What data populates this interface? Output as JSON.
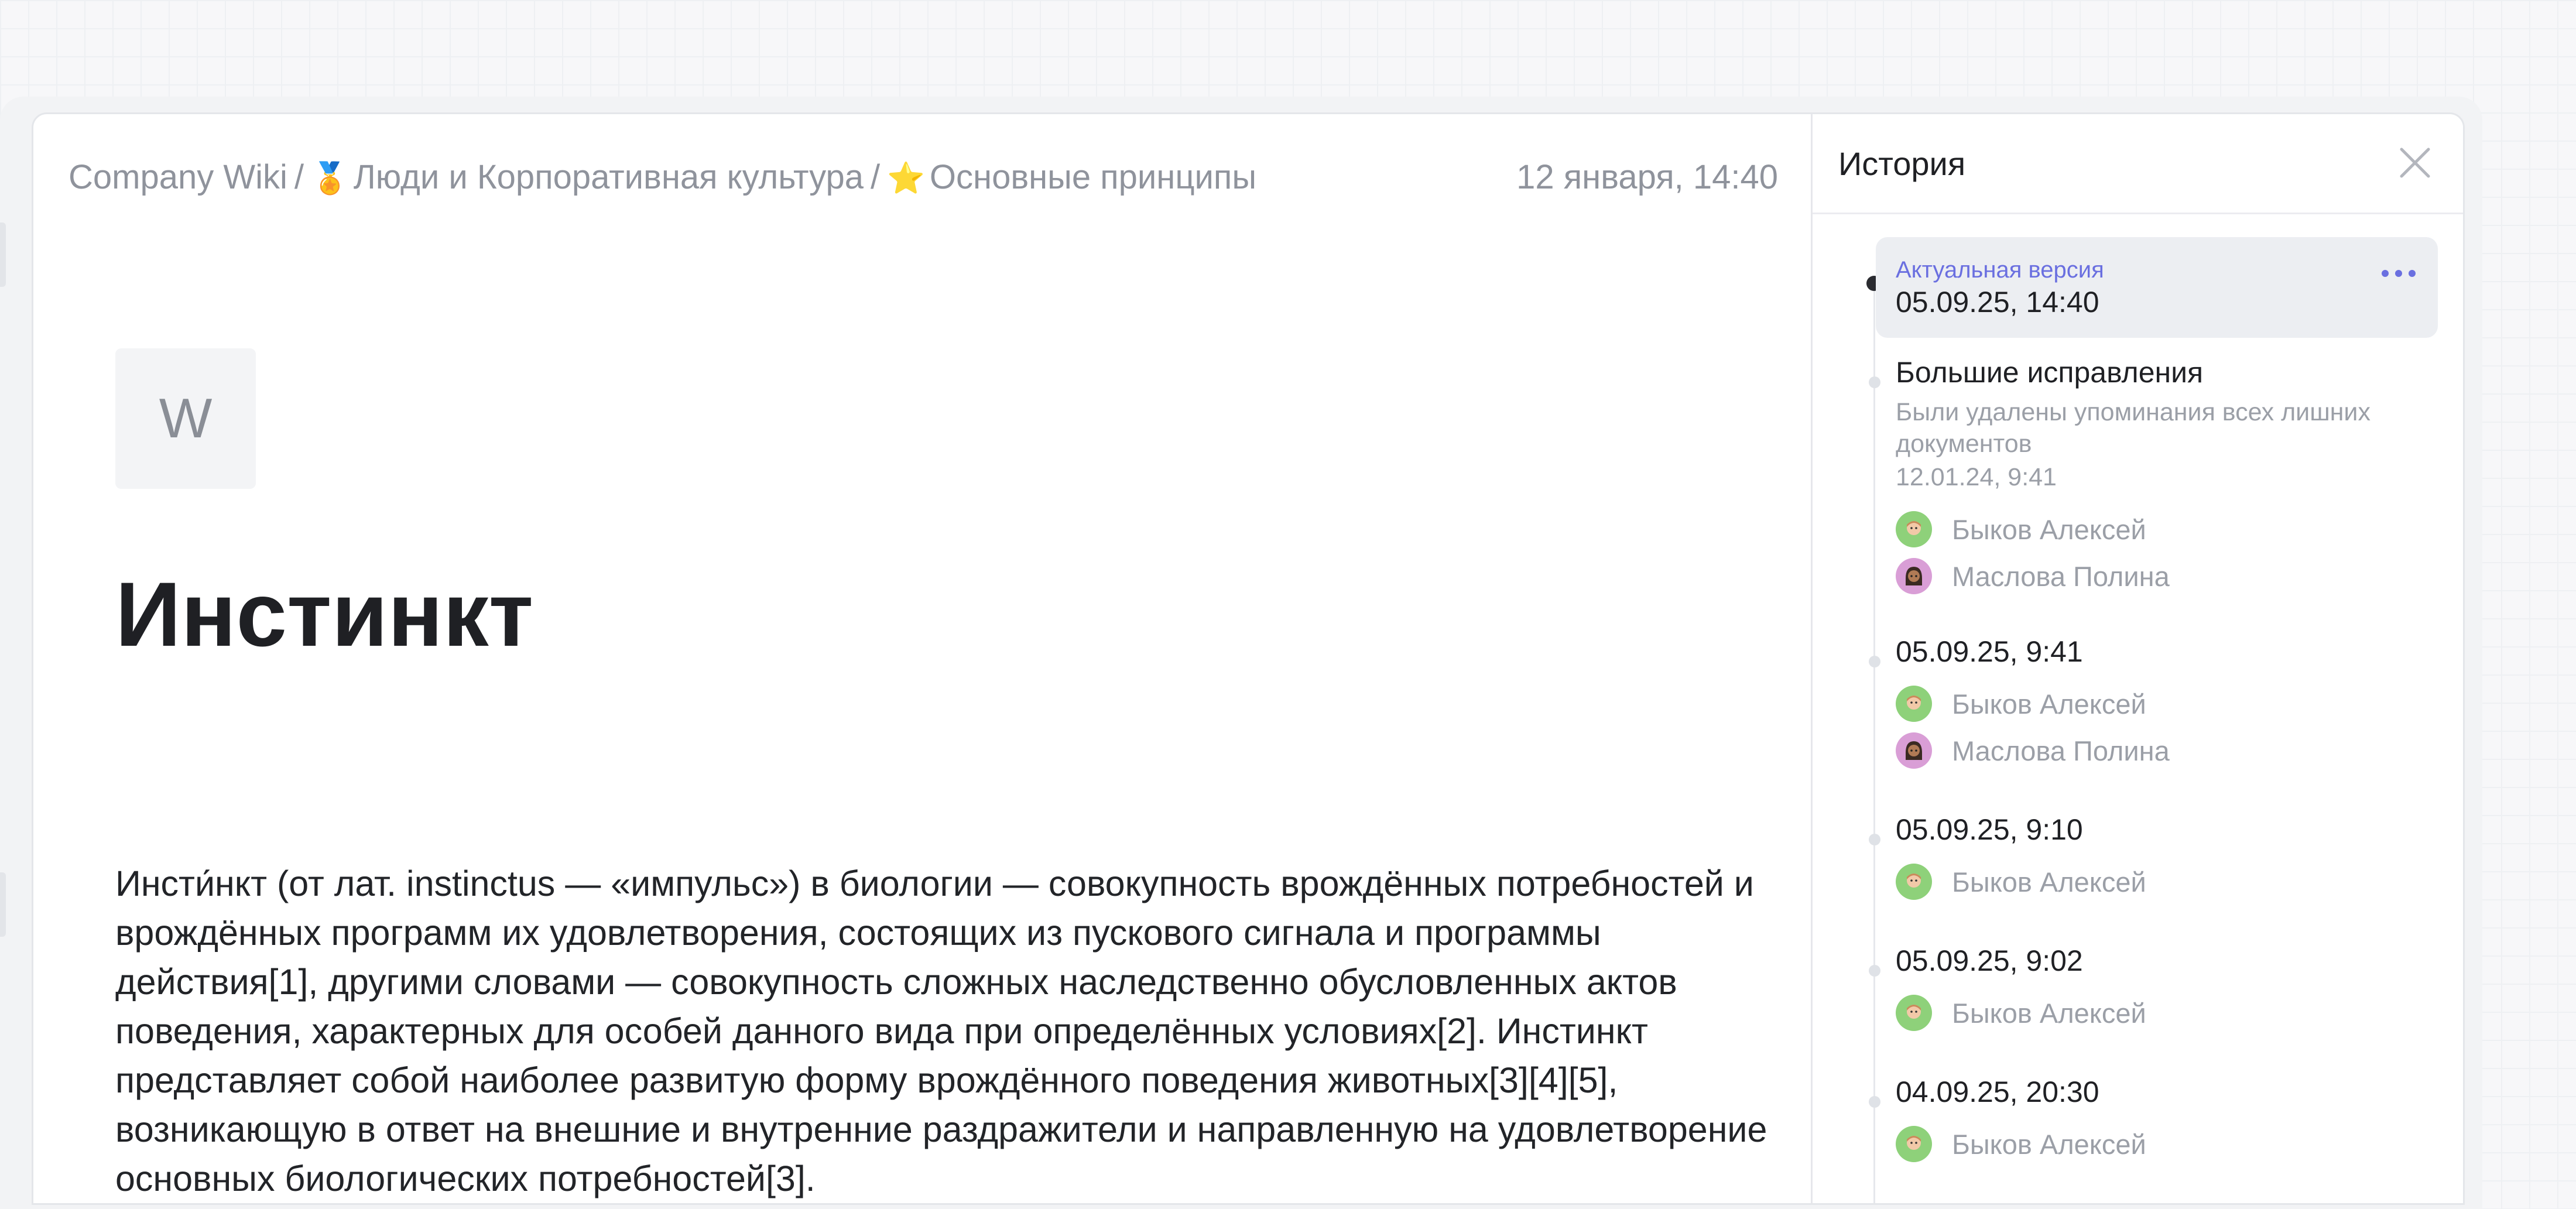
{
  "breadcrumb": {
    "root": "Company Wiki",
    "separator": "/",
    "section_emoji": "🏅",
    "section": "Люди и Корпоративная культура",
    "page_emoji": "⭐",
    "page": "Основные принципы"
  },
  "document": {
    "edited_at": "12 января, 14:40",
    "icon_letter": "W",
    "title": "Инстинкт",
    "body": "Инсти́нкт (от лат. instinctus — «импульс») в биологии — совокупность врождённых потребностей и врождённых программ их удовлетворения, состоящих из пускового сигнала и программы действия[1], другими словами — совокупность сложных наследственно обусловленных актов поведения, характерных для особей данного вида при определённых условиях[2]. Инстинкт представляет собой наиболее развитую форму врождённого поведения животных[3][4][5], возникающую в ответ на внешние и внутренние раздражители и направленную на удовлетворение основных биологических потребностей[3]."
  },
  "history": {
    "title": "История",
    "current": {
      "label": "Актуальная версия",
      "timestamp": "05.09.25, 14:40"
    },
    "versions": [
      {
        "title": "Большие исправления",
        "description": "Были удалены упоминания всех лишних документов",
        "date": "12.01.24, 9:41",
        "authors": [
          "Быков Алексей",
          "Маслова Полина"
        ]
      },
      {
        "title": "05.09.25, 9:41",
        "authors": [
          "Быков Алексей",
          "Маслова Полина"
        ]
      },
      {
        "title": "05.09.25, 9:10",
        "authors": [
          "Быков Алексей"
        ]
      },
      {
        "title": "05.09.25, 9:02",
        "authors": [
          "Быков Алексей"
        ]
      },
      {
        "title": "04.09.25, 20:30",
        "authors": [
          "Быков Алексей"
        ]
      }
    ]
  },
  "colors": {
    "accent": "#6a6fe0",
    "avatar_green": "#8ed17a",
    "avatar_pink": "#d99ed6"
  },
  "icons": {
    "close": "close-icon",
    "more": "more-icon",
    "avatar_1": "memoji-avatar-icon",
    "avatar_2": "memoji-avatar-icon"
  }
}
